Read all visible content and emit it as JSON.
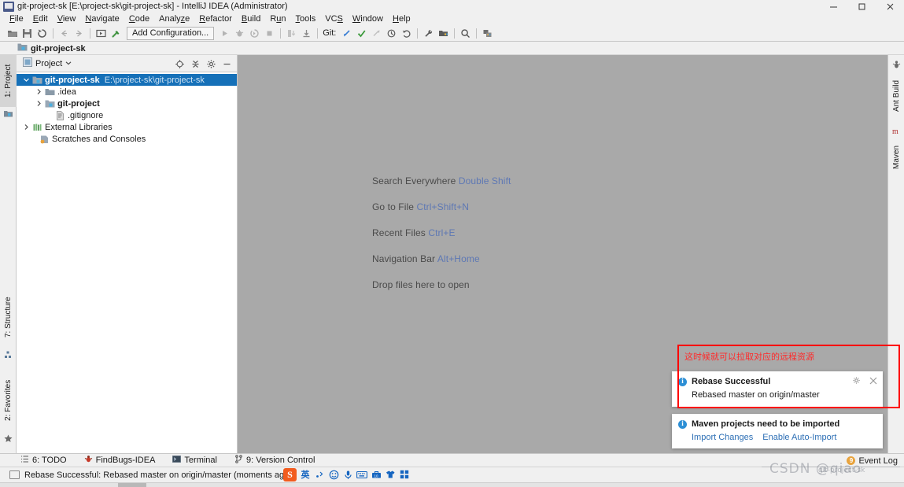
{
  "window": {
    "title": "git-project-sk [E:\\project-sk\\git-project-sk] - IntelliJ IDEA (Administrator)",
    "controls": {
      "minimize": "minimize-icon",
      "maximize": "maximize-icon",
      "close": "close-icon"
    }
  },
  "menubar": {
    "items": [
      {
        "label": "File",
        "mnemonic": "F"
      },
      {
        "label": "Edit",
        "mnemonic": "E"
      },
      {
        "label": "View",
        "mnemonic": "V"
      },
      {
        "label": "Navigate",
        "mnemonic": "N"
      },
      {
        "label": "Code",
        "mnemonic": "C"
      },
      {
        "label": "Analyze",
        "mnemonic": "z"
      },
      {
        "label": "Refactor",
        "mnemonic": "R"
      },
      {
        "label": "Build",
        "mnemonic": "B"
      },
      {
        "label": "Run",
        "mnemonic": "u"
      },
      {
        "label": "Tools",
        "mnemonic": "T"
      },
      {
        "label": "VCS",
        "mnemonic": "S"
      },
      {
        "label": "Window",
        "mnemonic": "W"
      },
      {
        "label": "Help",
        "mnemonic": "H"
      }
    ]
  },
  "toolbar": {
    "open_label": "open-folder-icon",
    "save_label": "save-icon",
    "sync_label": "sync-icon",
    "back_label": "back-arrow-icon",
    "forward_label": "forward-arrow-icon",
    "run_config": "Add Configuration...",
    "git_label": "Git:",
    "search_label": "search-icon"
  },
  "navbar": {
    "project_name": "git-project-sk"
  },
  "left_stripe": {
    "tabs": [
      {
        "label": "1: Project",
        "selected": true
      },
      {
        "label": "7: Structure",
        "selected": false
      },
      {
        "label": "2: Favorites",
        "selected": false
      }
    ]
  },
  "right_stripe": {
    "tabs": [
      {
        "label": "Ant Build"
      },
      {
        "label": "Maven"
      }
    ]
  },
  "project_panel": {
    "title": "Project",
    "dropdown": "chevron-down-icon",
    "tools": [
      "locate-icon",
      "collapse-all-icon",
      "settings-gear-icon",
      "hide-icon"
    ],
    "tree": [
      {
        "indent": 0,
        "arrow": "expanded",
        "icon": "project-module-icon",
        "label": "git-project-sk",
        "path": "E:\\project-sk\\git-project-sk",
        "bold": true,
        "selected": true
      },
      {
        "indent": 1,
        "arrow": "collapsed",
        "icon": "folder-icon",
        "label": ".idea",
        "path": "",
        "bold": false,
        "selected": false
      },
      {
        "indent": 1,
        "arrow": "collapsed",
        "icon": "module-icon",
        "label": "git-project",
        "path": "",
        "bold": true,
        "selected": false
      },
      {
        "indent": 2,
        "arrow": "none",
        "icon": "gitignore-file-icon",
        "label": ".gitignore",
        "path": "",
        "bold": false,
        "selected": false
      },
      {
        "indent": 0,
        "arrow": "collapsed",
        "icon": "libraries-icon",
        "label": "External Libraries",
        "path": "",
        "bold": false,
        "selected": false
      },
      {
        "indent": 0,
        "arrow": "none",
        "icon": "scratches-icon",
        "label": "Scratches and Consoles",
        "path": "",
        "bold": false,
        "selected": false
      }
    ]
  },
  "editor": {
    "hints": [
      {
        "action": "Search Everywhere",
        "shortcut": "Double Shift"
      },
      {
        "action": "Go to File",
        "shortcut": "Ctrl+Shift+N"
      },
      {
        "action": "Recent Files",
        "shortcut": "Ctrl+E"
      },
      {
        "action": "Navigation Bar",
        "shortcut": "Alt+Home"
      },
      {
        "action": "Drop files here to open",
        "shortcut": ""
      }
    ]
  },
  "annotation": {
    "text": "这时候就可以拉取对应的远程资源",
    "color": "#ff0000"
  },
  "notifications": [
    {
      "title": "Rebase Successful",
      "body": "Rebased master on origin/master",
      "links": [],
      "has_actions": true,
      "settings_icon": "settings-gear-icon",
      "close_icon": "close-icon"
    },
    {
      "title": "Maven projects need to be imported",
      "body": "",
      "links": [
        "Import Changes",
        "Enable Auto-Import"
      ],
      "has_actions": false,
      "settings_icon": "",
      "close_icon": ""
    }
  ],
  "bottom_tabs": {
    "tabs": [
      {
        "label": "6: TODO",
        "icon": "todo-icon"
      },
      {
        "label": "FindBugs-IDEA",
        "icon": "findbugs-icon"
      },
      {
        "label": "Terminal",
        "icon": "terminal-icon"
      },
      {
        "label": "9: Version Control",
        "icon": "branch-icon"
      }
    ],
    "event_log": {
      "label": "Event Log",
      "count": "9"
    }
  },
  "statusbar": {
    "message": "Rebase Successful: Rebased master on origin/master (moments ago)"
  },
  "ime": {
    "logo": "S",
    "items": [
      "英",
      "punctuation-icon",
      "emoji-icon",
      "microphone-icon",
      "keyboard-icon",
      "toolbox-icon",
      "skin-icon",
      "apps-icon"
    ]
  },
  "watermark": {
    "text": "CSDN @qiao",
    "sub": "git-project-sk"
  }
}
